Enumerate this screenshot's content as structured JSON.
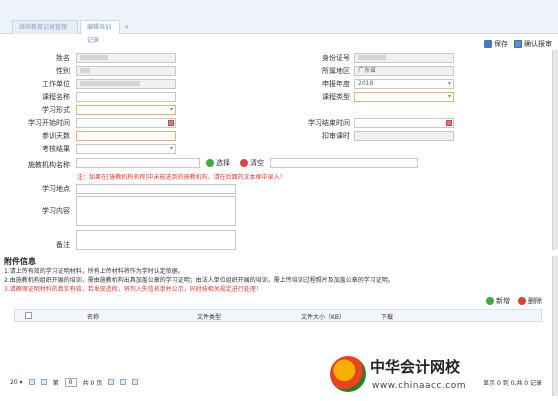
{
  "tabs": [
    {
      "label": "继续教育记录管理",
      "active": false
    },
    {
      "label": "编辑培训记录",
      "active": true,
      "close": "×"
    }
  ],
  "toolbar": {
    "save_label": "保存",
    "confirm_label": "确认报审"
  },
  "form": {
    "name_label": "姓名",
    "id_label": "身份证号",
    "gender_label": "性别",
    "region_label": "所属地区",
    "region_value": "广东省",
    "employer_label": "工作单位",
    "year_label": "申报年度",
    "year_value": "2018",
    "course_name_label": "课程名称",
    "course_type_label": "课程类型",
    "study_mode_label": "学习形式",
    "start_label": "学习开始时间",
    "end_label": "学习结束时间",
    "days_label": "参训天数",
    "hours_label": "扣审课时",
    "result_label": "考核结果",
    "inst_label": "施教机构名称",
    "select_btn": "选择",
    "clear_btn": "清空",
    "note": "注：如果在[施教机构名称]中未能选到的施教机构，请在后面的文本框中录入！",
    "place_label": "学习地点",
    "content_label": "学习内容",
    "remark_label": "备注"
  },
  "attachments": {
    "title": "附件信息",
    "lines": [
      "1.请上传有效的学习证明材料，所有上传材料将作为学时认定依据。",
      "2.由施教机构组织开展的培训，需由施教机构出具加盖公章的学习证明；由法人单位组织开展的培训，需上传培训过程照片及加盖公章的学习证明。",
      "3.请确保证明材料的真实有效，若发现造假，将列入失信名单并公示，同时按相关规定进行处理！"
    ],
    "add_label": "新增",
    "delete_label": "删除",
    "columns": [
      "名称",
      "文件类型",
      "文件大小（KB）",
      "下载"
    ],
    "pager": {
      "page_size": "20",
      "page_word": "第",
      "page": "0",
      "total_pages": "共 0 页",
      "summary": "显示 0 到 0,共 0 记录"
    }
  },
  "watermark": {
    "title": "中华会计网校",
    "url": "www.chinaacc.com"
  }
}
